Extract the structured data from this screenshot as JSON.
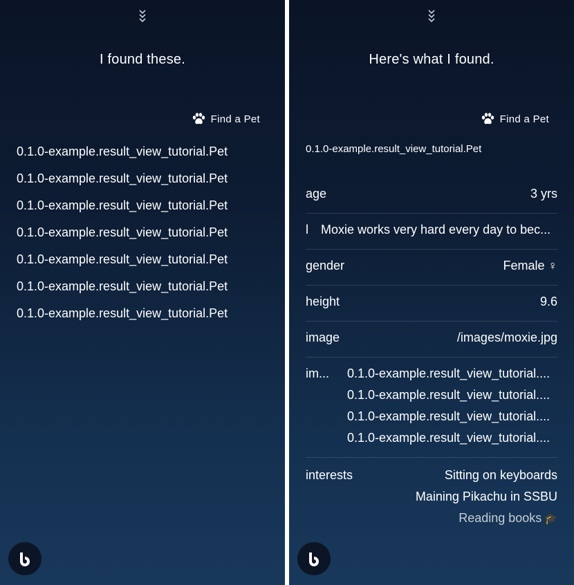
{
  "left_panel": {
    "headline": "I found these.",
    "capsule": "Find a Pet",
    "results": [
      "0.1.0-example.result_view_tutorial.Pet",
      "0.1.0-example.result_view_tutorial.Pet",
      "0.1.0-example.result_view_tutorial.Pet",
      "0.1.0-example.result_view_tutorial.Pet",
      "0.1.0-example.result_view_tutorial.Pet",
      "0.1.0-example.result_view_tutorial.Pet",
      "0.1.0-example.result_view_tutorial.Pet"
    ]
  },
  "right_panel": {
    "headline": "Here's what I found.",
    "capsule": "Find a Pet",
    "title": "0.1.0-example.result_view_tutorial.Pet",
    "age": {
      "key": "age",
      "value": "3 yrs"
    },
    "description": {
      "key": "l",
      "value": "Moxie works very hard every day to bec..."
    },
    "gender": {
      "key": "gender",
      "value": "Female ♀"
    },
    "height": {
      "key": "height",
      "value": "9.6"
    },
    "image": {
      "key": "image",
      "value": "/images/moxie.jpg"
    },
    "images": {
      "key": "im...",
      "values": [
        "0.1.0-example.result_view_tutorial....",
        "0.1.0-example.result_view_tutorial....",
        "0.1.0-example.result_view_tutorial....",
        "0.1.0-example.result_view_tutorial...."
      ]
    },
    "interests": {
      "key": "interests",
      "values": [
        "Sitting on keyboards",
        "Maining Pikachu in SSBU",
        "Reading books"
      ]
    }
  },
  "icons": {
    "collapse": "chevron-triple-down-icon",
    "capsule": "paw-icon",
    "assistant": "bixby-icon",
    "interest_emoji": "graduation-cap-icon"
  },
  "colors": {
    "background_top": "#0a1426",
    "background_bottom": "#18385b",
    "text": "#ffffff",
    "divider": "rgba(255,255,255,0.13)"
  }
}
